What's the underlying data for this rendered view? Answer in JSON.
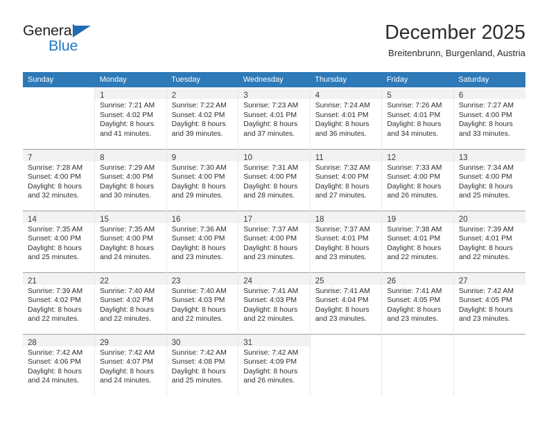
{
  "brand": {
    "name_part1": "General",
    "name_part2": "Blue",
    "triangle_icon": "triangle-icon",
    "accent_dark": "#231f20",
    "accent_blue": "#1f7ac4",
    "triangle_blue": "#1f6cb0"
  },
  "header": {
    "title": "December 2025",
    "location": "Breitenbrunn, Burgenland, Austria"
  },
  "colors": {
    "header_row_bg": "#2e7ab8",
    "header_row_text": "#ffffff",
    "daynum_band_bg": "#f2f2f2",
    "cell_bg": "#ffffff",
    "grid_line": "#9f9f9f",
    "cell_divider": "#e8e8e8"
  },
  "calendar": {
    "weekday_headers": [
      "Sunday",
      "Monday",
      "Tuesday",
      "Wednesday",
      "Thursday",
      "Friday",
      "Saturday"
    ],
    "weeks": [
      [
        {
          "day": "",
          "lines": []
        },
        {
          "day": "1",
          "lines": [
            "Sunrise: 7:21 AM",
            "Sunset: 4:02 PM",
            "Daylight: 8 hours",
            "and 41 minutes."
          ]
        },
        {
          "day": "2",
          "lines": [
            "Sunrise: 7:22 AM",
            "Sunset: 4:02 PM",
            "Daylight: 8 hours",
            "and 39 minutes."
          ]
        },
        {
          "day": "3",
          "lines": [
            "Sunrise: 7:23 AM",
            "Sunset: 4:01 PM",
            "Daylight: 8 hours",
            "and 37 minutes."
          ]
        },
        {
          "day": "4",
          "lines": [
            "Sunrise: 7:24 AM",
            "Sunset: 4:01 PM",
            "Daylight: 8 hours",
            "and 36 minutes."
          ]
        },
        {
          "day": "5",
          "lines": [
            "Sunrise: 7:26 AM",
            "Sunset: 4:01 PM",
            "Daylight: 8 hours",
            "and 34 minutes."
          ]
        },
        {
          "day": "6",
          "lines": [
            "Sunrise: 7:27 AM",
            "Sunset: 4:00 PM",
            "Daylight: 8 hours",
            "and 33 minutes."
          ]
        }
      ],
      [
        {
          "day": "7",
          "lines": [
            "Sunrise: 7:28 AM",
            "Sunset: 4:00 PM",
            "Daylight: 8 hours",
            "and 32 minutes."
          ]
        },
        {
          "day": "8",
          "lines": [
            "Sunrise: 7:29 AM",
            "Sunset: 4:00 PM",
            "Daylight: 8 hours",
            "and 30 minutes."
          ]
        },
        {
          "day": "9",
          "lines": [
            "Sunrise: 7:30 AM",
            "Sunset: 4:00 PM",
            "Daylight: 8 hours",
            "and 29 minutes."
          ]
        },
        {
          "day": "10",
          "lines": [
            "Sunrise: 7:31 AM",
            "Sunset: 4:00 PM",
            "Daylight: 8 hours",
            "and 28 minutes."
          ]
        },
        {
          "day": "11",
          "lines": [
            "Sunrise: 7:32 AM",
            "Sunset: 4:00 PM",
            "Daylight: 8 hours",
            "and 27 minutes."
          ]
        },
        {
          "day": "12",
          "lines": [
            "Sunrise: 7:33 AM",
            "Sunset: 4:00 PM",
            "Daylight: 8 hours",
            "and 26 minutes."
          ]
        },
        {
          "day": "13",
          "lines": [
            "Sunrise: 7:34 AM",
            "Sunset: 4:00 PM",
            "Daylight: 8 hours",
            "and 25 minutes."
          ]
        }
      ],
      [
        {
          "day": "14",
          "lines": [
            "Sunrise: 7:35 AM",
            "Sunset: 4:00 PM",
            "Daylight: 8 hours",
            "and 25 minutes."
          ]
        },
        {
          "day": "15",
          "lines": [
            "Sunrise: 7:35 AM",
            "Sunset: 4:00 PM",
            "Daylight: 8 hours",
            "and 24 minutes."
          ]
        },
        {
          "day": "16",
          "lines": [
            "Sunrise: 7:36 AM",
            "Sunset: 4:00 PM",
            "Daylight: 8 hours",
            "and 23 minutes."
          ]
        },
        {
          "day": "17",
          "lines": [
            "Sunrise: 7:37 AM",
            "Sunset: 4:00 PM",
            "Daylight: 8 hours",
            "and 23 minutes."
          ]
        },
        {
          "day": "18",
          "lines": [
            "Sunrise: 7:37 AM",
            "Sunset: 4:01 PM",
            "Daylight: 8 hours",
            "and 23 minutes."
          ]
        },
        {
          "day": "19",
          "lines": [
            "Sunrise: 7:38 AM",
            "Sunset: 4:01 PM",
            "Daylight: 8 hours",
            "and 22 minutes."
          ]
        },
        {
          "day": "20",
          "lines": [
            "Sunrise: 7:39 AM",
            "Sunset: 4:01 PM",
            "Daylight: 8 hours",
            "and 22 minutes."
          ]
        }
      ],
      [
        {
          "day": "21",
          "lines": [
            "Sunrise: 7:39 AM",
            "Sunset: 4:02 PM",
            "Daylight: 8 hours",
            "and 22 minutes."
          ]
        },
        {
          "day": "22",
          "lines": [
            "Sunrise: 7:40 AM",
            "Sunset: 4:02 PM",
            "Daylight: 8 hours",
            "and 22 minutes."
          ]
        },
        {
          "day": "23",
          "lines": [
            "Sunrise: 7:40 AM",
            "Sunset: 4:03 PM",
            "Daylight: 8 hours",
            "and 22 minutes."
          ]
        },
        {
          "day": "24",
          "lines": [
            "Sunrise: 7:41 AM",
            "Sunset: 4:03 PM",
            "Daylight: 8 hours",
            "and 22 minutes."
          ]
        },
        {
          "day": "25",
          "lines": [
            "Sunrise: 7:41 AM",
            "Sunset: 4:04 PM",
            "Daylight: 8 hours",
            "and 23 minutes."
          ]
        },
        {
          "day": "26",
          "lines": [
            "Sunrise: 7:41 AM",
            "Sunset: 4:05 PM",
            "Daylight: 8 hours",
            "and 23 minutes."
          ]
        },
        {
          "day": "27",
          "lines": [
            "Sunrise: 7:42 AM",
            "Sunset: 4:05 PM",
            "Daylight: 8 hours",
            "and 23 minutes."
          ]
        }
      ],
      [
        {
          "day": "28",
          "lines": [
            "Sunrise: 7:42 AM",
            "Sunset: 4:06 PM",
            "Daylight: 8 hours",
            "and 24 minutes."
          ]
        },
        {
          "day": "29",
          "lines": [
            "Sunrise: 7:42 AM",
            "Sunset: 4:07 PM",
            "Daylight: 8 hours",
            "and 24 minutes."
          ]
        },
        {
          "day": "30",
          "lines": [
            "Sunrise: 7:42 AM",
            "Sunset: 4:08 PM",
            "Daylight: 8 hours",
            "and 25 minutes."
          ]
        },
        {
          "day": "31",
          "lines": [
            "Sunrise: 7:42 AM",
            "Sunset: 4:09 PM",
            "Daylight: 8 hours",
            "and 26 minutes."
          ]
        },
        {
          "day": "",
          "lines": []
        },
        {
          "day": "",
          "lines": []
        },
        {
          "day": "",
          "lines": []
        }
      ]
    ]
  }
}
